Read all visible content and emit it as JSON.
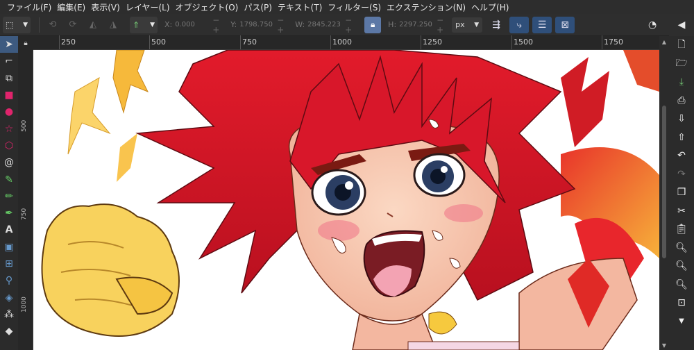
{
  "menu": [
    "ファイル(F)",
    "編集(E)",
    "表示(V)",
    "レイヤー(L)",
    "オブジェクト(O)",
    "パス(P)",
    "テキスト(T)",
    "フィルター(S)",
    "エクステンション(N)",
    "ヘルプ(H)"
  ],
  "toolbar": {
    "x_label": "X:",
    "x_value": "0.000",
    "y_label": "Y:",
    "y_value": "1798.750",
    "w_label": "W:",
    "w_value": "2845.223",
    "h_label": "H:",
    "h_value": "2297.250",
    "unit": "px"
  },
  "ruler_h": [
    "250",
    "500",
    "750",
    "1000",
    "1250",
    "1500",
    "1750"
  ],
  "ruler_v": [
    "500",
    "750",
    "1000"
  ],
  "colors": {
    "accent": "#5c78a6",
    "hair": "#d81e2c",
    "skin": "#f6c9b0"
  }
}
